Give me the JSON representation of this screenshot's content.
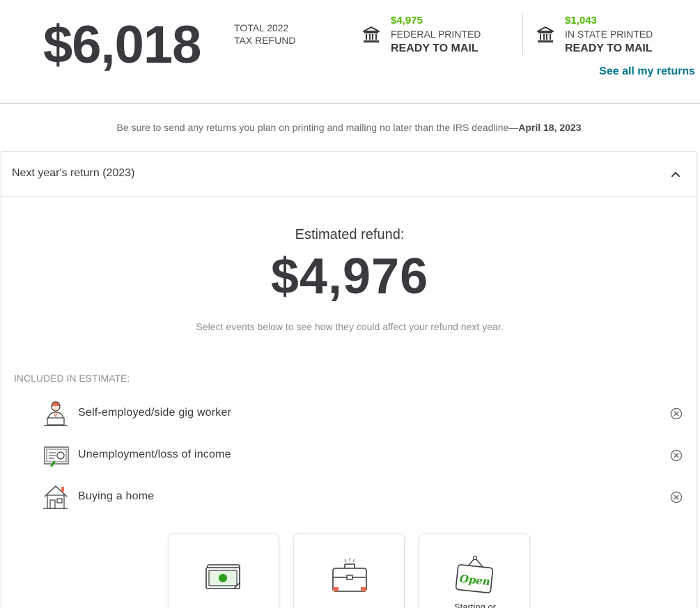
{
  "summary": {
    "total_amount": "$6,018",
    "total_label_line1": "TOTAL 2022",
    "total_label_line2": "TAX REFUND",
    "federal": {
      "amount": "$4,975",
      "label": "FEDERAL PRINTED",
      "status": "READY TO MAIL"
    },
    "state": {
      "amount": "$1,043",
      "label": "IN STATE PRINTED",
      "status": "READY TO MAIL"
    },
    "see_all": "See all my returns",
    "icons": {
      "return_icon": "bank-building-icon"
    },
    "colors": {
      "refund_green": "#53b700",
      "link_teal": "#00758c"
    }
  },
  "deadline": {
    "text": "Be sure to send any returns you plan on printing and mailing no later than the IRS deadline—",
    "date": "April 18, 2023"
  },
  "next_year": {
    "header": "Next year's return (2023)",
    "estimated_label": "Estimated refund:",
    "estimated_amount": "$4,976",
    "help_text": "Select events below to see how they could affect your refund next year.",
    "included_label": "INCLUDED IN ESTIMATE:",
    "events": [
      {
        "label": "Self-employed/side gig worker",
        "icon": "freelancer-laptop-icon"
      },
      {
        "label": "Unemployment/loss of income",
        "icon": "unemployment-document-icon"
      },
      {
        "label": "Buying a home",
        "icon": "house-icon"
      }
    ],
    "tiles": [
      {
        "icon": "cash-money-icon",
        "label": ""
      },
      {
        "icon": "briefcase-icon",
        "label": ""
      },
      {
        "icon": "open-sign-icon",
        "label": "Starting or"
      }
    ],
    "open_sign_text": "Open"
  }
}
